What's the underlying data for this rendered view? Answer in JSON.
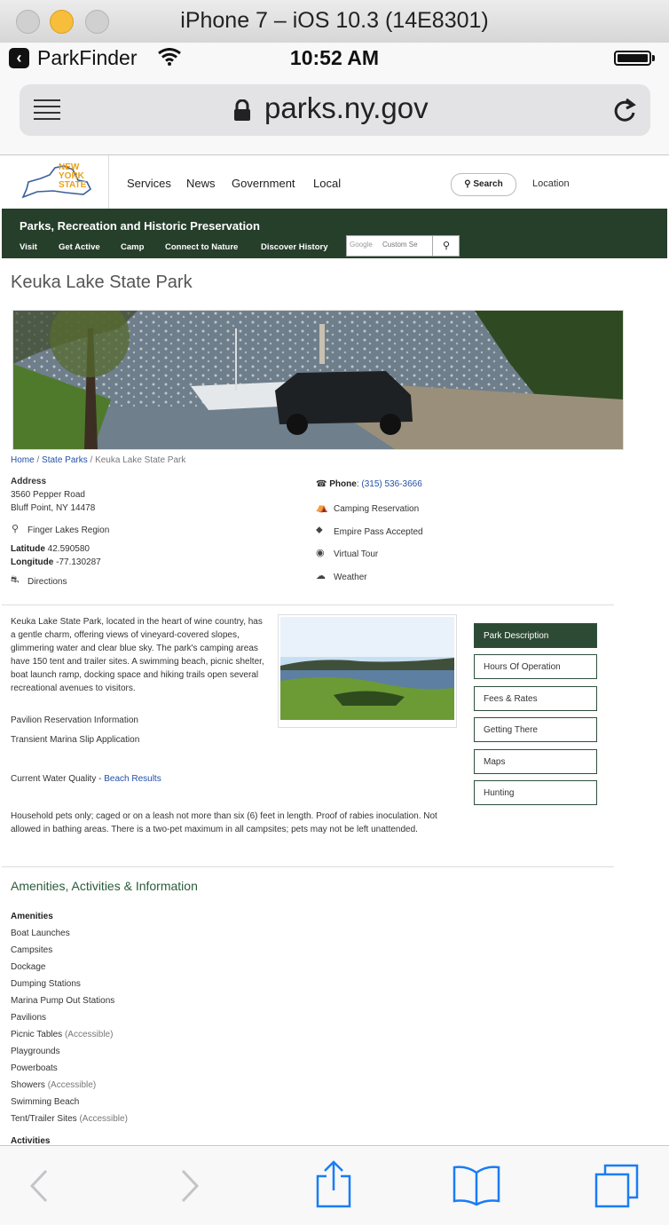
{
  "simulator": {
    "title": "iPhone 7 – iOS 10.3 (14E8301)"
  },
  "status": {
    "app_name": "ParkFinder",
    "time": "10:52 AM"
  },
  "browser": {
    "url": "parks.ny.gov"
  },
  "site": {
    "logo": {
      "line1": "NEW",
      "line2": "YORK",
      "line3": "STATE"
    },
    "top_nav": [
      "Services",
      "News",
      "Government",
      "Local"
    ],
    "search_label": "Search",
    "location_label": "Location",
    "agency_title": "Parks, Recreation and Historic Preservation",
    "agency_nav": [
      "Visit",
      "Get Active",
      "Camp",
      "Connect to Nature",
      "Discover History"
    ],
    "google_label": "Google",
    "custom_search_placeholder": "Custom Se"
  },
  "park": {
    "title": "Keuka Lake State Park",
    "breadcrumb": {
      "home": "Home",
      "sep1": " / ",
      "parks": "State Parks",
      "sep2": " / ",
      "current": "Keuka Lake State Park"
    },
    "address_label": "Address",
    "address_line1": "3560 Pepper Road",
    "address_line2": "Bluff Point, NY 14478",
    "region": "Finger Lakes Region",
    "latitude_label": "Latitude",
    "latitude": "42.590580",
    "longitude_label": "Longitude",
    "longitude": "-77.130287",
    "directions": "Directions",
    "phone_label": "Phone",
    "phone": "(315) 536-3666",
    "camping": "Camping Reservation",
    "empire_pass": "Empire Pass Accepted",
    "virtual_tour": "Virtual Tour",
    "weather": "Weather",
    "description": "Keuka Lake State Park, located in the heart of wine country, has a gentle charm, offering views of vineyard-covered slopes, glimmering water and clear blue sky. The park's camping areas have 150 tent and trailer sites. A swimming beach, picnic shelter, boat launch ramp, docking space and hiking trails open several recreational avenues to visitors.",
    "pavilion_link": "Pavilion Reservation Information",
    "marina_link": "Transient Marina Slip Application",
    "water_quality_label": "Current Water Quality - ",
    "water_quality_link": "Beach Results",
    "pets_text": "Household pets only; caged or on a leash not more than six (6) feet in length. Proof of rabies inoculation. Not allowed in bathing areas. There is a two-pet maximum in all campsites; pets may not be left unattended.",
    "tabs": [
      "Park Description",
      "Hours Of Operation",
      "Fees & Rates",
      "Getting There",
      "Maps",
      "Hunting"
    ],
    "amenities_title": "Amenities, Activities & Information",
    "amenities_heading": "Amenities",
    "amenities": [
      {
        "name": "Boat Launches",
        "note": ""
      },
      {
        "name": "Campsites",
        "note": ""
      },
      {
        "name": "Dockage",
        "note": ""
      },
      {
        "name": "Dumping Stations",
        "note": ""
      },
      {
        "name": "Marina Pump Out Stations",
        "note": ""
      },
      {
        "name": "Pavilions",
        "note": ""
      },
      {
        "name": "Picnic Tables",
        "note": "(Accessible)"
      },
      {
        "name": "Playgrounds",
        "note": ""
      },
      {
        "name": "Powerboats",
        "note": ""
      },
      {
        "name": "Showers",
        "note": "(Accessible)"
      },
      {
        "name": "Swimming Beach",
        "note": ""
      },
      {
        "name": "Tent/Trailer Sites",
        "note": "(Accessible)"
      }
    ],
    "activities_heading": "Activities"
  },
  "colors": {
    "agency_green": "#263f2b",
    "link_blue": "#2250a8",
    "ios_blue": "#1a7cf5"
  }
}
